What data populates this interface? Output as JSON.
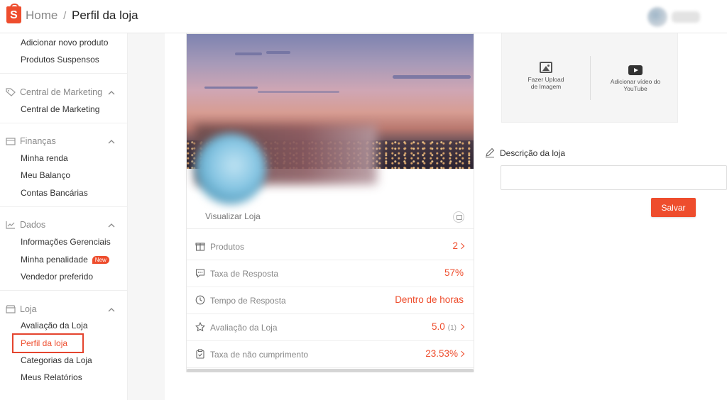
{
  "header": {
    "home": "Home",
    "separator": "/",
    "current": "Perfil da loja",
    "logo_letter": "S"
  },
  "sidebar": {
    "top_items": [
      "Adicionar novo produto",
      "Produtos Suspensos"
    ],
    "marketing": {
      "title": "Central de Marketing",
      "items": [
        "Central de Marketing"
      ]
    },
    "financas": {
      "title": "Finanças",
      "items": [
        "Minha renda",
        "Meu Balanço",
        "Contas Bancárias"
      ]
    },
    "dados": {
      "title": "Dados",
      "items": [
        "Informações Gerenciais",
        "Minha penalidade",
        "Vendedor preferido"
      ],
      "badge": "New"
    },
    "loja": {
      "title": "Loja",
      "items": [
        "Avaliação da Loja",
        "Perfil da loja",
        "Categorias da Loja",
        "Meus Relatórios"
      ],
      "active": "Perfil da loja"
    }
  },
  "profile": {
    "view_store": "Visualizar Loja",
    "stats": [
      {
        "icon": "gift-icon",
        "label": "Produtos",
        "value": "2",
        "extra": "",
        "arrow": true
      },
      {
        "icon": "chat-icon",
        "label": "Taxa de Resposta",
        "value": "57%",
        "extra": "",
        "arrow": false
      },
      {
        "icon": "clock-icon",
        "label": "Tempo de Resposta",
        "value": "Dentro de horas",
        "extra": "",
        "arrow": false
      },
      {
        "icon": "star-icon",
        "label": "Avaliação da Loja",
        "value": "5.0",
        "extra": "(1)",
        "arrow": true
      },
      {
        "icon": "clipboard-icon",
        "label": "Taxa de não cumprimento",
        "value": "23.53%",
        "extra": "",
        "arrow": true
      }
    ]
  },
  "media": {
    "upload_image": "Fazer Upload de Imagem",
    "youtube": "Adicionar vídeo do YouTube"
  },
  "description": {
    "label": "Descrição da loja",
    "value": "",
    "save": "Salvar"
  },
  "colors": {
    "accent": "#ee4d2d",
    "highlight_box": "#e4442e"
  }
}
